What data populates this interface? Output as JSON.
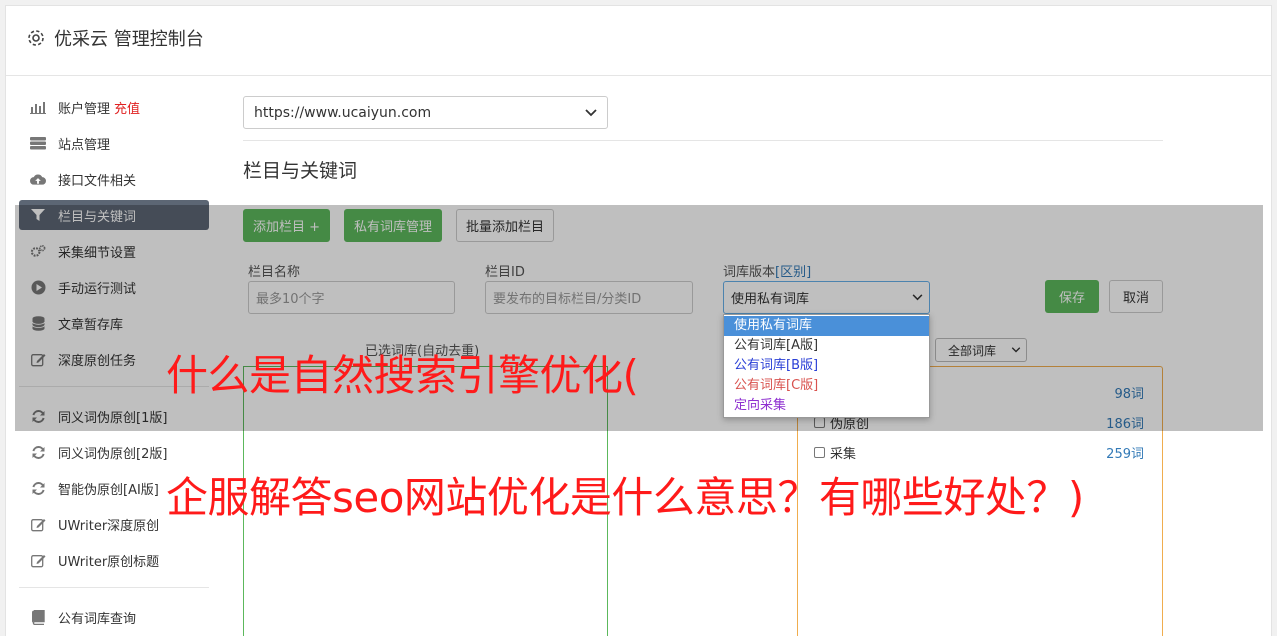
{
  "app": {
    "title": "优采云 管理控制台"
  },
  "sidebar": {
    "items": [
      {
        "label": "账户管理",
        "extra": "充值",
        "icon": "bar-chart-icon"
      },
      {
        "label": "站点管理",
        "icon": "server-icon"
      },
      {
        "label": "接口文件相关",
        "icon": "cloud-upload-icon"
      },
      {
        "label": "栏目与关键词",
        "icon": "filter-icon",
        "active": true
      },
      {
        "label": "采集细节设置",
        "icon": "cogs-icon"
      },
      {
        "label": "手动运行测试",
        "icon": "play-circle-icon"
      },
      {
        "label": "文章暂存库",
        "icon": "database-icon"
      },
      {
        "label": "深度原创任务",
        "icon": "edit-icon"
      }
    ],
    "items2": [
      {
        "label": "同义词伪原创[1版]",
        "icon": "refresh-icon"
      },
      {
        "label": "同义词伪原创[2版]",
        "icon": "refresh-icon"
      },
      {
        "label": "智能伪原创[AI版]",
        "icon": "refresh-icon"
      },
      {
        "label": "UWriter深度原创",
        "icon": "edit-icon"
      },
      {
        "label": "UWriter原创标题",
        "icon": "edit-icon"
      }
    ],
    "items3": [
      {
        "label": "公有词库查询",
        "icon": "book-icon"
      }
    ]
  },
  "main": {
    "site_select": "https://www.ucaiyun.com",
    "section_title": "栏目与关键词",
    "buttons": {
      "add": "添加栏目 +",
      "private_lib": "私有词库管理",
      "batch_add": "批量添加栏目"
    },
    "form": {
      "name_label": "栏目名称",
      "name_placeholder": "最多10个字",
      "id_label": "栏目ID",
      "id_placeholder": "要发布的目标栏目/分类ID",
      "lib_label": "词库版本",
      "lib_label_link": "[区别]",
      "lib_selected": "使用私有词库",
      "save": "保存",
      "cancel": "取消"
    },
    "selected_label": "已选词库(自动去重)",
    "filter_select": "全部词库",
    "dropdown_options": [
      {
        "label": "使用私有词库",
        "color": "#ffffff"
      },
      {
        "label": "公有词库[A版]",
        "color": "#333333"
      },
      {
        "label": "公有词库[B版]",
        "color": "#2a3fd6"
      },
      {
        "label": "公有词库[C版]",
        "color": "#d9534f"
      },
      {
        "label": "定向采集",
        "color": "#8e2fd0"
      }
    ],
    "libraries": [
      {
        "name": "",
        "count": "98词"
      },
      {
        "name": "伪原创",
        "count": "186词"
      },
      {
        "name": "采集",
        "count": "259词"
      }
    ]
  },
  "headline": {
    "line1": "什么是自然搜索引擎优化(",
    "line2": "企服解答seo网站优化是什么意思？有哪些好处？)"
  }
}
